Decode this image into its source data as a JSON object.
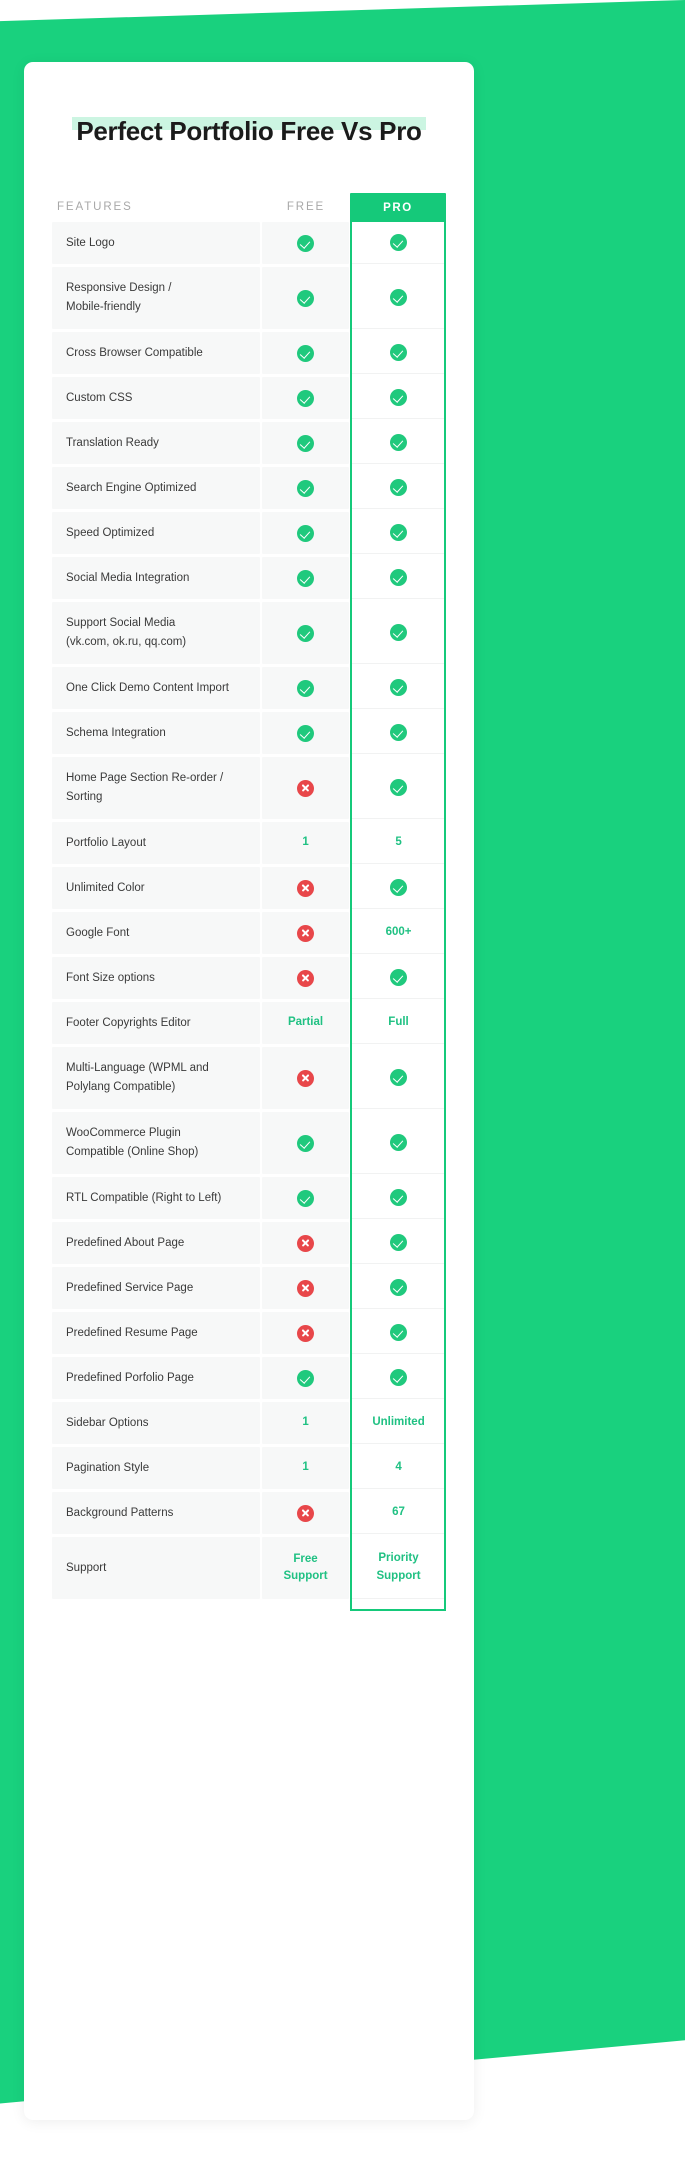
{
  "theme": {
    "green": "#19d17e",
    "green_dark": "#15c97a",
    "green_text": "#20c183",
    "red": "#e8474a",
    "highlight": "#ccf5e2",
    "row_bg": "#f7f8f8",
    "label_gray": "#a8a8a8"
  },
  "title": "Perfect Portfolio Free Vs Pro",
  "columns": {
    "features": "FEATURES",
    "free": "FREE",
    "pro": "PRO"
  },
  "rows": [
    {
      "feature": "Site Logo",
      "free": {
        "type": "yes"
      },
      "pro": {
        "type": "yes"
      },
      "lines": 1
    },
    {
      "feature": "Responsive Design /\nMobile-friendly",
      "free": {
        "type": "yes"
      },
      "pro": {
        "type": "yes"
      },
      "lines": 2
    },
    {
      "feature": "Cross Browser Compatible",
      "free": {
        "type": "yes"
      },
      "pro": {
        "type": "yes"
      },
      "lines": 1
    },
    {
      "feature": "Custom CSS",
      "free": {
        "type": "yes"
      },
      "pro": {
        "type": "yes"
      },
      "lines": 1
    },
    {
      "feature": "Translation Ready",
      "free": {
        "type": "yes"
      },
      "pro": {
        "type": "yes"
      },
      "lines": 1
    },
    {
      "feature": "Search Engine Optimized",
      "free": {
        "type": "yes"
      },
      "pro": {
        "type": "yes"
      },
      "lines": 1
    },
    {
      "feature": "Speed Optimized",
      "free": {
        "type": "yes"
      },
      "pro": {
        "type": "yes"
      },
      "lines": 1
    },
    {
      "feature": "Social Media Integration",
      "free": {
        "type": "yes"
      },
      "pro": {
        "type": "yes"
      },
      "lines": 1
    },
    {
      "feature": "Support Social Media\n(vk.com, ok.ru, qq.com)",
      "free": {
        "type": "yes"
      },
      "pro": {
        "type": "yes"
      },
      "lines": 2
    },
    {
      "feature": "One Click Demo Content Import",
      "free": {
        "type": "yes"
      },
      "pro": {
        "type": "yes"
      },
      "lines": 1
    },
    {
      "feature": "Schema Integration",
      "free": {
        "type": "yes"
      },
      "pro": {
        "type": "yes"
      },
      "lines": 1
    },
    {
      "feature": "Home Page Section Re-order /\nSorting",
      "free": {
        "type": "no"
      },
      "pro": {
        "type": "yes"
      },
      "lines": 2
    },
    {
      "feature": "Portfolio Layout",
      "free": {
        "type": "text",
        "text": "1"
      },
      "pro": {
        "type": "text",
        "text": "5"
      },
      "lines": 1
    },
    {
      "feature": "Unlimited Color",
      "free": {
        "type": "no"
      },
      "pro": {
        "type": "yes"
      },
      "lines": 1
    },
    {
      "feature": "Google Font",
      "free": {
        "type": "no"
      },
      "pro": {
        "type": "text",
        "text": "600+"
      },
      "lines": 1
    },
    {
      "feature": "Font Size options",
      "free": {
        "type": "no"
      },
      "pro": {
        "type": "yes"
      },
      "lines": 1
    },
    {
      "feature": "Footer Copyrights Editor",
      "free": {
        "type": "text",
        "text": "Partial"
      },
      "pro": {
        "type": "text",
        "text": "Full"
      },
      "lines": 1
    },
    {
      "feature": "Multi-Language (WPML and\nPolylang Compatible)",
      "free": {
        "type": "no"
      },
      "pro": {
        "type": "yes"
      },
      "lines": 2
    },
    {
      "feature": "WooCommerce Plugin\nCompatible (Online Shop)",
      "free": {
        "type": "yes"
      },
      "pro": {
        "type": "yes"
      },
      "lines": 2
    },
    {
      "feature": "RTL Compatible (Right to Left)",
      "free": {
        "type": "yes"
      },
      "pro": {
        "type": "yes"
      },
      "lines": 1
    },
    {
      "feature": "Predefined About Page",
      "free": {
        "type": "no"
      },
      "pro": {
        "type": "yes"
      },
      "lines": 1
    },
    {
      "feature": "Predefined Service Page",
      "free": {
        "type": "no"
      },
      "pro": {
        "type": "yes"
      },
      "lines": 1
    },
    {
      "feature": "Predefined Resume Page",
      "free": {
        "type": "no"
      },
      "pro": {
        "type": "yes"
      },
      "lines": 1
    },
    {
      "feature": "Predefined Porfolio Page",
      "free": {
        "type": "yes"
      },
      "pro": {
        "type": "yes"
      },
      "lines": 1
    },
    {
      "feature": "Sidebar Options",
      "free": {
        "type": "text",
        "text": "1"
      },
      "pro": {
        "type": "text",
        "text": "Unlimited"
      },
      "lines": 1
    },
    {
      "feature": "Pagination Style",
      "free": {
        "type": "text",
        "text": "1"
      },
      "pro": {
        "type": "text",
        "text": "4"
      },
      "lines": 1
    },
    {
      "feature": "Background Patterns",
      "free": {
        "type": "no"
      },
      "pro": {
        "type": "text",
        "text": "67"
      },
      "lines": 1
    },
    {
      "feature": "Support",
      "free": {
        "type": "text",
        "text": "Free\nSupport"
      },
      "pro": {
        "type": "text",
        "text": "Priority\nSupport"
      },
      "lines": 2
    }
  ]
}
